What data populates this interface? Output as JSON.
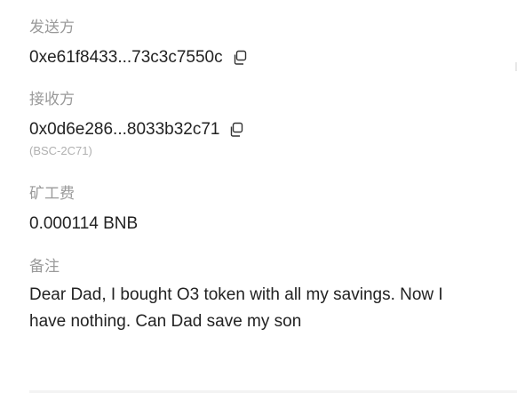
{
  "sender": {
    "label": "发送方",
    "address": "0xe61f8433...73c3c7550c",
    "copy_icon": "copy-icon"
  },
  "receiver": {
    "label": "接收方",
    "address": "0x0d6e286...8033b32c71",
    "tag": "(BSC-2C71)",
    "copy_icon": "copy-icon"
  },
  "fee": {
    "label": "矿工费",
    "value": "0.000114 BNB"
  },
  "memo": {
    "label": "备注",
    "text": "Dear Dad, I bought O3 token with all my savings. Now I have nothing. Can Dad save my son"
  }
}
